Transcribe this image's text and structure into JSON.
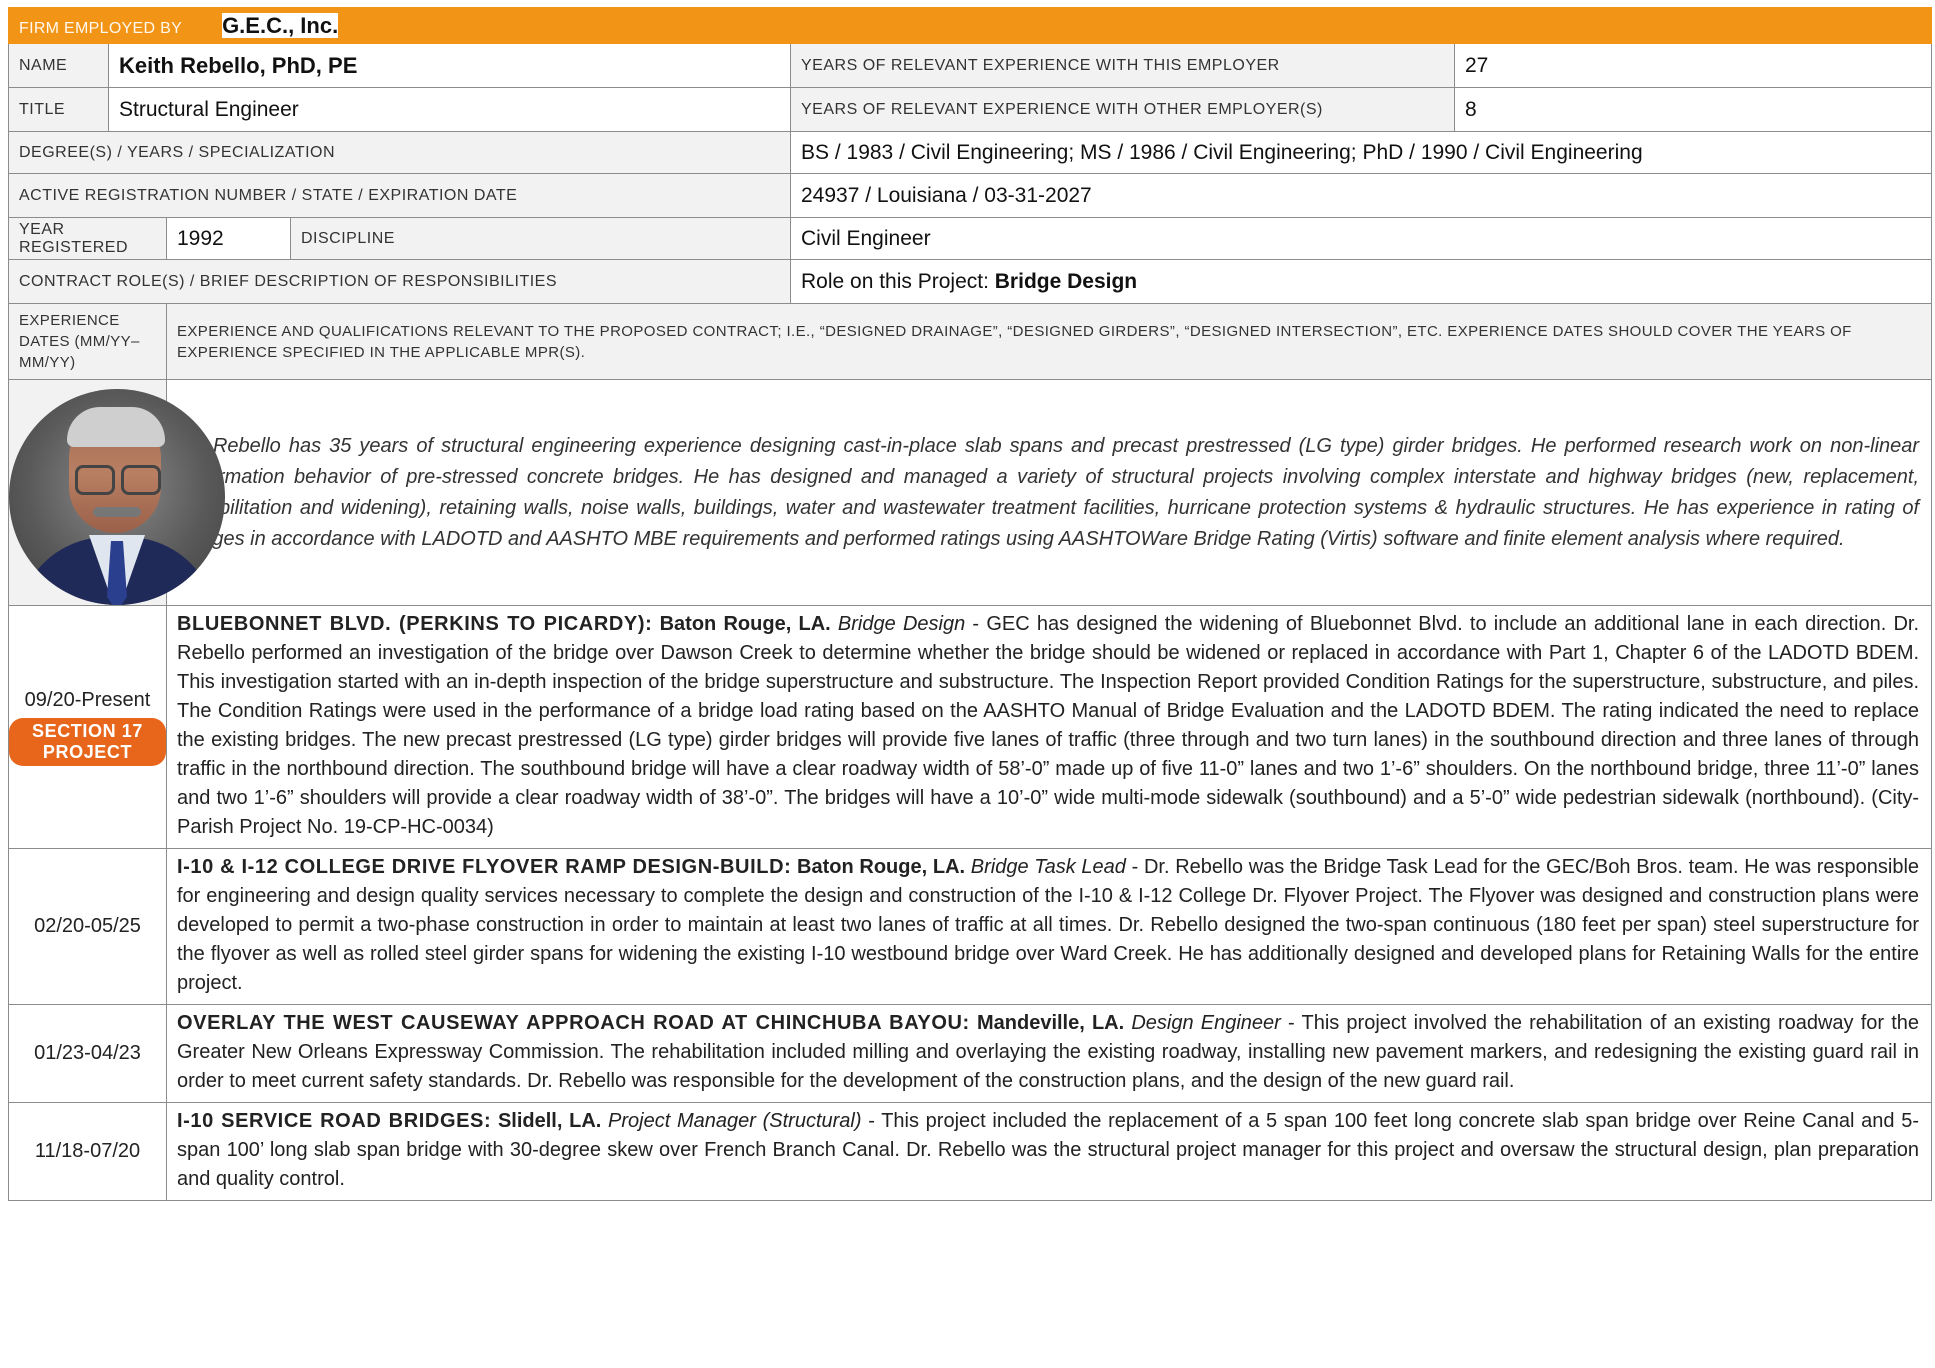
{
  "firm": {
    "label": "FIRM EMPLOYED BY",
    "value": "G.E.C., Inc."
  },
  "name": {
    "label": "NAME",
    "value": "Keith Rebello, PhD, PE"
  },
  "title": {
    "label": "TITLE",
    "value": "Structural Engineer"
  },
  "years_this": {
    "label": "YEARS OF RELEVANT EXPERIENCE WITH THIS EMPLOYER",
    "value": "27"
  },
  "years_other": {
    "label": "YEARS OF RELEVANT EXPERIENCE WITH OTHER EMPLOYER(S)",
    "value": "8"
  },
  "degrees": {
    "label": "DEGREE(S) / YEARS / SPECIALIZATION",
    "value": "BS / 1983 / Civil Engineering; MS / 1986 / Civil Engineering; PhD / 1990 / Civil Engineering"
  },
  "registration": {
    "label": "ACTIVE REGISTRATION NUMBER / STATE / EXPIRATION DATE",
    "value": "24937 / Louisiana / 03-31-2027"
  },
  "year_registered": {
    "label": "YEAR REGISTERED",
    "value": "1992"
  },
  "discipline": {
    "label": "DISCIPLINE",
    "value": "Civil Engineer"
  },
  "role": {
    "label": "CONTRACT ROLE(S) / BRIEF DESCRIPTION OF RESPONSIBILITIES",
    "prefix": "Role on this Project: ",
    "value": "Bridge Design"
  },
  "exp_dates_label": "EXPERIENCE DATES (MM/YY–MM/YY)",
  "exp_desc_label": "EXPERIENCE AND QUALIFICATIONS RELEVANT TO THE PROPOSED CONTRACT; I.E., “DESIGNED DRAINAGE”, “DESIGNED GIRDERS”, “DESIGNED INTERSECTION”, ETC.  EXPERIENCE DATES SHOULD COVER THE YEARS OF EXPERIENCE SPECIFIED IN THE APPLICABLE MPR(S).",
  "bio": "Dr. Rebello has 35 years of structural engineering experience designing cast-in-place slab spans and precast prestressed (LG type) girder bridges. He performed research work on non-linear deformation behavior of pre-stressed concrete bridges. He has designed and managed a variety of structural projects involving complex interstate and highway bridges (new, replacement, rehabilitation and widening), retaining walls, noise walls, buildings, water and wastewater treatment facilities, hurricane protection systems & hydraulic structures. He has experience in rating of bridges in accordance with LADOTD and AASHTO MBE requirements and performed ratings using AASHTOWare Bridge Rating (Virtis) software and finite element analysis where required.",
  "projects": [
    {
      "dates": "09/20-Present",
      "badge": "SECTION 17 PROJECT",
      "title": "BLUEBONNET BLVD. (PERKINS TO PICARDY):",
      "location": " Baton Rouge, LA.",
      "role": " Bridge Design",
      "desc": " - GEC has designed the widening of Bluebonnet Blvd. to include an additional lane in each direction. Dr. Rebello performed an investigation of the bridge over Dawson Creek to determine whether the bridge should be widened or replaced in accordance with Part 1, Chapter 6 of the LADOTD BDEM. This investigation started with an in-depth inspection of the bridge superstructure and substructure. The Inspection Report provided Condition Ratings for the superstructure, substructure, and piles. The Condition Ratings were used in the performance of a bridge load rating based on the AASHTO Manual of Bridge Evaluation and the LADOTD BDEM. The rating indicated the need to replace the existing bridges. The new precast prestressed (LG type) girder bridges will provide five lanes of traffic (three through and two turn lanes) in the southbound direction and three lanes of through traffic in the northbound direction. The southbound bridge will have a clear roadway width of 58’-0” made up of five 11-0” lanes and two 1’-6” shoulders.  On the northbound bridge, three 11’-0” lanes and two 1’-6” shoulders will provide a clear roadway width of 38’-0”. The bridges will have a 10’-0” wide multi-mode sidewalk (southbound) and a 5’-0” wide pedestrian sidewalk (northbound). (City-Parish Project No. 19-CP-HC-0034)"
    },
    {
      "dates": "02/20-05/25",
      "badge": "",
      "title": "I-10 & I-12 COLLEGE DRIVE FLYOVER RAMP DESIGN-BUILD:",
      "location": " Baton Rouge, LA.",
      "role": " Bridge Task Lead",
      "desc": " - Dr. Rebello was the Bridge Task Lead for the GEC/Boh Bros. team.  He was responsible for engineering and design quality services necessary to complete the design and construction of the I-10 & I-12 College Dr. Flyover Project.  The Flyover was designed and construction plans were developed to permit a two-phase construction in order to maintain at least two lanes of traffic at all times.  Dr. Rebello designed the two-span continuous (180 feet per span) steel superstructure for the flyover as well as rolled steel girder spans for widening the existing I-10 westbound bridge over Ward Creek. He has additionally designed and developed plans for Retaining Walls for the entire project."
    },
    {
      "dates": "01/23-04/23",
      "badge": "",
      "title": "OVERLAY THE WEST CAUSEWAY APPROACH ROAD AT CHINCHUBA BAYOU:",
      "location": " Mandeville, LA.",
      "role": " Design Engineer",
      "desc": " - This project involved the rehabilitation of an existing roadway for the Greater New Orleans Expressway Commission. The rehabilitation included milling and overlaying the existing roadway, installing new pavement markers, and redesigning the existing guard rail in order to meet current safety standards. Dr. Rebello was responsible for the development of the construction plans, and the design of the new guard rail."
    },
    {
      "dates": "11/18-07/20",
      "badge": "",
      "title": "I-10 SERVICE ROAD BRIDGES:",
      "location": " Slidell, LA.",
      "role": " Project Manager (Structural)",
      "desc": " - This project included the replacement of a 5 span 100 feet long concrete slab span bridge over Reine Canal and 5-span 100’ long slab span bridge with 30-degree skew over French Branch Canal. Dr. Rebello was the structural project manager for this project and oversaw the structural design, plan preparation and quality control."
    }
  ]
}
